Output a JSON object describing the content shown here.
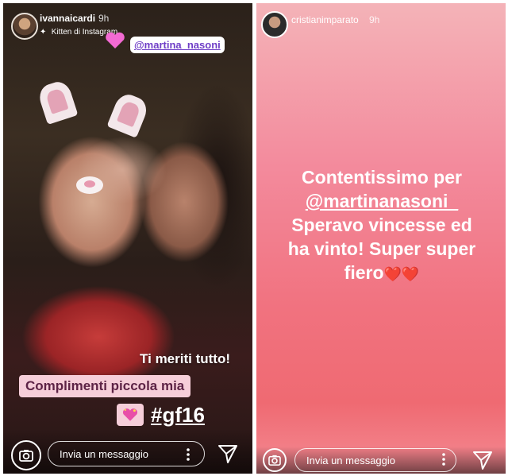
{
  "left_story": {
    "username": "ivannaicardi",
    "time": "9h",
    "filter_label": "Kitten di Instagram",
    "filter_icon": "sparkle-icon",
    "mention_sticker": "@martina_nasoni",
    "caption_line1": "Ti meriti tutto!",
    "caption_line2": "Complimenti piccola mia",
    "hashtag": "#gf16",
    "message_placeholder": "Invia un messaggio"
  },
  "right_story": {
    "username": "cristianimparato",
    "time": "9h",
    "text_line1": "Contentissimo per",
    "mention": "@martinanasoni_",
    "text_line3": "Speravo vincesse ed",
    "text_line4": "ha vinto! Super super",
    "text_line5": "fiero",
    "hearts": "❤️❤️",
    "message_placeholder": "Invia un messaggio"
  },
  "colors": {
    "right_background": "#f1727f",
    "sticker_pink": "#f6ced9",
    "mention_purple": "#6f3ec7"
  }
}
